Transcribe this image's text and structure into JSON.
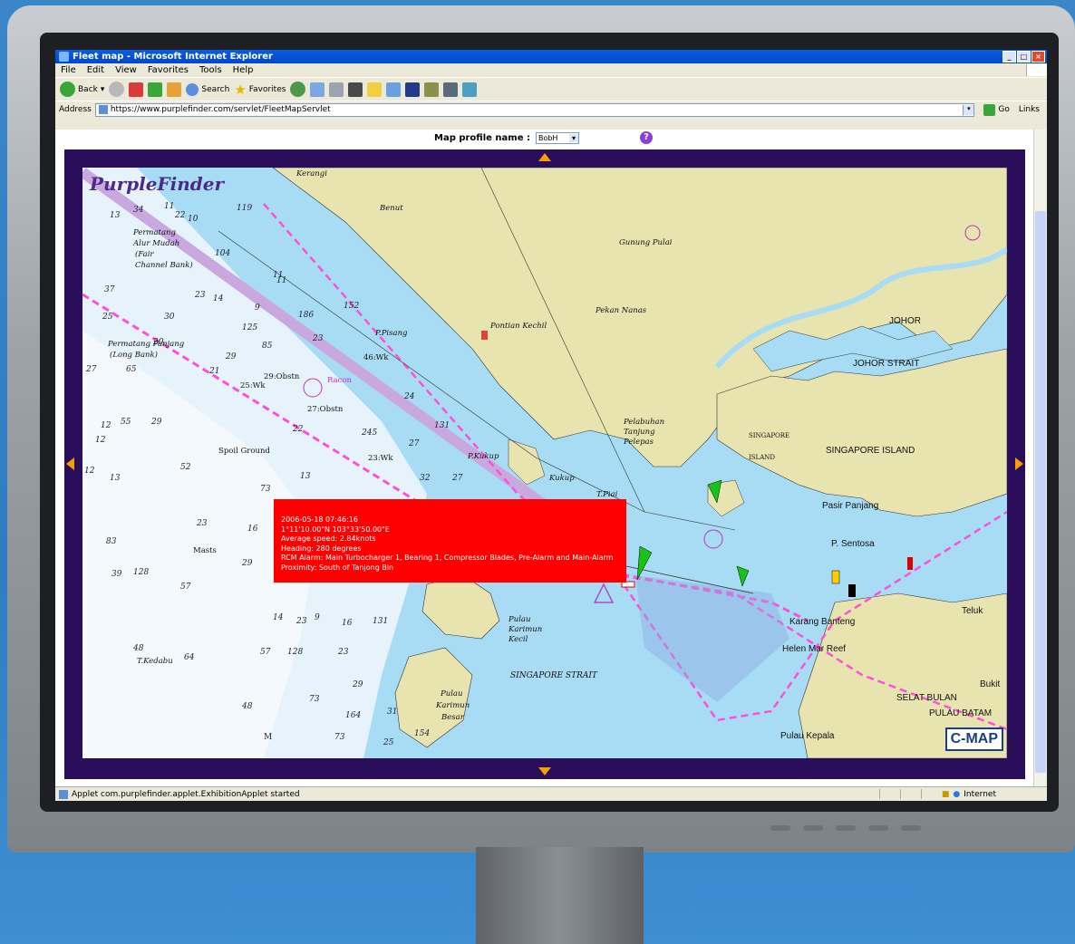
{
  "window": {
    "title": "Fleet map - Microsoft Internet Explorer"
  },
  "menu": [
    "File",
    "Edit",
    "View",
    "Favorites",
    "Tools",
    "Help"
  ],
  "toolbar": {
    "back": "Back",
    "search": "Search",
    "favorites": "Favorites"
  },
  "address": {
    "label": "Address",
    "url": "https://www.purplefinder.com/servlet/FleetMapServlet",
    "go": "Go",
    "links": "Links"
  },
  "profile": {
    "label": "Map profile name :",
    "value": "BobH",
    "help": "?"
  },
  "logo": "PurpleFinder",
  "popup": {
    "line1": "2006-05-18 07:46:16",
    "line2": "1°11'10.00\"N 103°33'50.00\"E",
    "line3": "Average speed: 2.84knots",
    "line4": "Heading: 280 degrees",
    "line5": "RCM Alarm: Main Turbocharger 1, Bearing 1, Compressor Blades, Pre-Alarm and Main-Alarm",
    "line6": "Proximity: South of Tanjong Bin"
  },
  "map_labels": {
    "benut": "Benut",
    "gunung_pulai": "Gunung Pulai",
    "pekan_nanas": "Pekan Nanas",
    "pontian": "Pontian Kechil",
    "p_pisang": "P.Pisang",
    "pelabuhan": "Pelabuhan",
    "tanjung": "Tanjung",
    "pelepas": "Pelepas",
    "p_kukup": "P.Kukup",
    "kukup": "Kukup",
    "t_piai": "T.Piai",
    "johor": "JOHOR",
    "johor_strait": "JOHOR STRAIT",
    "singapore_island1": "SINGAPORE",
    "singapore_island2": "ISLAND",
    "singapore_island": "SINGAPORE ISLAND",
    "pasir_panjang": "Pasir Panjang",
    "p_sentosa": "P. Sentosa",
    "singapore_strait": "SINGAPORE STRAIT",
    "pulau_karimun_kecil1": "Pulau",
    "pulau_karimun_kecil2": "Karimun",
    "pulau_karimun_kecil3": "Kecil",
    "pulau_karimun_besar1": "Pulau",
    "pulau_karimun_besar2": "Karimun",
    "pulau_karimun_besar3": "Besar",
    "permatang_alur1": "Permatang",
    "permatang_alur2": "Alur Mudah",
    "permatang_alur3": "(Fair",
    "permatang_alur4": "Channel Bank)",
    "permatang_panjang1": "Permatang Panjang",
    "permatang_panjang2": "(Long Bank)",
    "t_kedabu": "T.Kedabu",
    "spoil_ground": "Spoil Ground",
    "masts": "Masts",
    "racon": "Racon",
    "kerangi": "Kerangi",
    "teluk": "Teluk",
    "pulau_batam": "PULAU BATAM",
    "selat_bulan": "SELAT BULAN",
    "bukit": "Bukit",
    "karang": "Karang Banteng",
    "helen": "Helen Mar Reef",
    "pulau_kepala": "Pulau Kepala",
    "obstn1": "29:Obstn",
    "obstn2": "27:Obstn",
    "wk1": "25:Wk",
    "wk2": "46:Wk",
    "wk3": "23:Wk"
  },
  "map_depths": [
    "13",
    "34",
    "11",
    "22",
    "10",
    "119",
    "104",
    "23",
    "14",
    "11",
    "152",
    "186",
    "125",
    "23",
    "85",
    "20",
    "25",
    "29",
    "27",
    "21",
    "30",
    "37",
    "65",
    "9",
    "11",
    "24",
    "29",
    "131",
    "245",
    "27",
    "27",
    "22",
    "13",
    "32",
    "16",
    "29",
    "12",
    "128",
    "57",
    "14",
    "23",
    "9",
    "16",
    "131",
    "48",
    "57",
    "128",
    "64",
    "23",
    "29",
    "73",
    "48",
    "164",
    "25",
    "73",
    "31",
    "154",
    "M",
    "55",
    "52",
    "73",
    "13",
    "23",
    "12",
    "83",
    "39",
    "12"
  ],
  "cmap_logo": "C-MAP",
  "status": {
    "text": "Applet com.purplefinder.applet.ExhibitionApplet started",
    "zone": "Internet"
  },
  "colors": {
    "sea": "#a8dcf5",
    "land": "#e8e4b0",
    "shallow": "#e6f3fb",
    "frame": "#2a0e5c",
    "popup": "#ff0000",
    "route": "#ff4fd8",
    "channel": "#c9a8e0"
  }
}
